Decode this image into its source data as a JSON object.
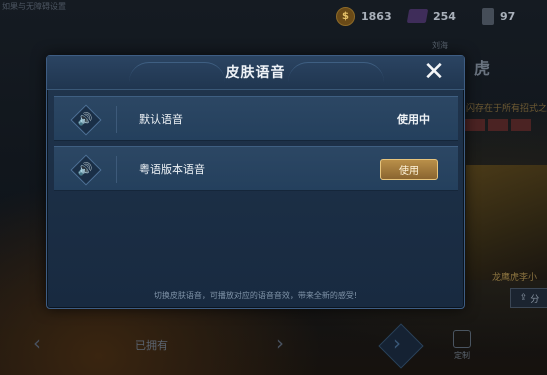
{
  "background": {
    "top_hint": "如果与无障碍设置",
    "resources": [
      {
        "name": "gold-coin",
        "value": "1863"
      },
      {
        "name": "diamond",
        "value": "254"
      },
      {
        "name": "voucher",
        "value": "97"
      }
    ],
    "hero": {
      "tag": "刘海",
      "title": "虎",
      "desc": "闪存在于所有招式之外",
      "portrait_name": "龙鹰虎李小",
      "share": "分"
    },
    "bottom": {
      "owned": "已拥有",
      "custom": "定制"
    }
  },
  "dialog": {
    "title": "皮肤语音",
    "close": "✕",
    "voices": [
      {
        "label": "默认语音",
        "status": "使用中"
      },
      {
        "label": "粤语版本语音",
        "button": "使用"
      }
    ],
    "hint": "切换皮肤语音，可播放对应的语音音效，带来全新的感受!"
  },
  "colors": {
    "accent_gold": "#b98f49",
    "dialog_border": "#3e5d83"
  },
  "icons": {
    "speaker": "🔊",
    "prev": "‹",
    "next": "›"
  }
}
